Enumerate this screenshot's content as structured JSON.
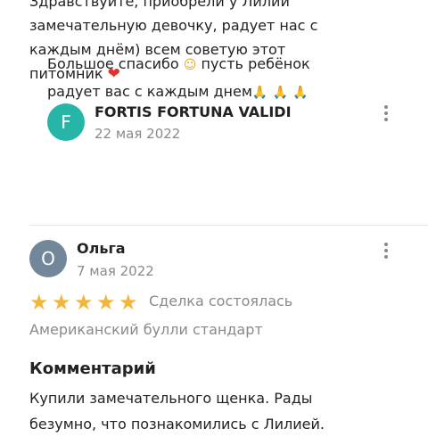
{
  "review1": {
    "text_lines": [
      "Здравствуйте, приобрели у Лилии",
      "замечательную девочку, радует нас с",
      "каждым днём) всем советую этот",
      "питомник"
    ],
    "emoji": "heart-emoji"
  },
  "reply": {
    "avatar_letter": "F",
    "avatar_color": "#26b5a6",
    "author": "FORTIS FORTUNA VALIDI",
    "date": "22 мая 2022",
    "text_lines": [
      "Большое спасибо",
      "пусть ребёнок",
      "радует вас с каждым днем"
    ],
    "emojis": [
      "smiling-face-with-hearts-emoji",
      "folded-hands-emoji"
    ]
  },
  "review2": {
    "avatar_letter": "О",
    "avatar_color": "#72879a",
    "author": "Ольга",
    "date": "7 мая 2022",
    "rating": 5,
    "rating_max": 5,
    "star_color": "#f3b63c",
    "deal_status": "Сделка состоялась",
    "breed": "Американский булли стандарт",
    "comment_heading": "Комментарий",
    "comment_lines": [
      "Купили замечательного щенка. Рады",
      "безумно, что познакомились с Лилией."
    ]
  }
}
